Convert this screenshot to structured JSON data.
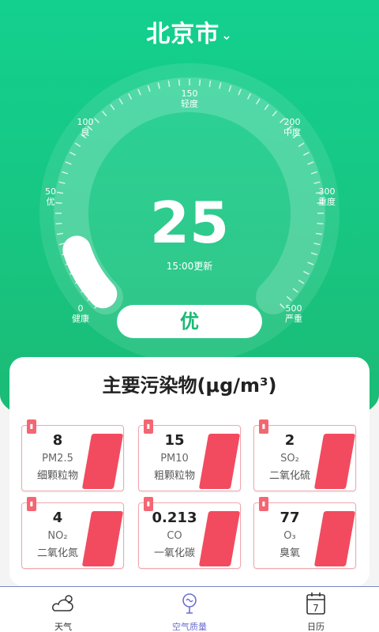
{
  "header": {
    "city": "北京市",
    "chevron_icon": "chevron-down-icon"
  },
  "gauge": {
    "value": "25",
    "level_value": 25,
    "level_max": 500,
    "updated": "15:00更新",
    "level": "优",
    "ticks": [
      {
        "num": "0",
        "text": "健康"
      },
      {
        "num": "50",
        "text": "优"
      },
      {
        "num": "100",
        "text": "良"
      },
      {
        "num": "150",
        "text": "轻度"
      },
      {
        "num": "200",
        "text": "中度"
      },
      {
        "num": "300",
        "text": "重度"
      },
      {
        "num": "500",
        "text": "严重"
      }
    ]
  },
  "pollutants": {
    "title": "主要污染物(μg/m³)",
    "items": [
      {
        "value": "8",
        "code": "PM2.5",
        "name": "细颗粒物"
      },
      {
        "value": "15",
        "code": "PM10",
        "name": "粗颗粒物"
      },
      {
        "value": "2",
        "code": "SO₂",
        "name": "二氧化硫"
      },
      {
        "value": "4",
        "code": "NO₂",
        "name": "二氧化氮"
      },
      {
        "value": "0.213",
        "code": "CO",
        "name": "一氧化碳"
      },
      {
        "value": "77",
        "code": "O₃",
        "name": "臭氧"
      }
    ]
  },
  "nav": {
    "items": [
      {
        "label": "天气",
        "icon": "weather-icon"
      },
      {
        "label": "空气质量",
        "icon": "air-quality-icon"
      },
      {
        "label": "日历",
        "icon": "calendar-icon"
      }
    ],
    "calendar_day": "7"
  },
  "colors": {
    "accent": "#18c47f",
    "pollutant": "#f24b5f",
    "nav_active": "#6b6fcf"
  }
}
